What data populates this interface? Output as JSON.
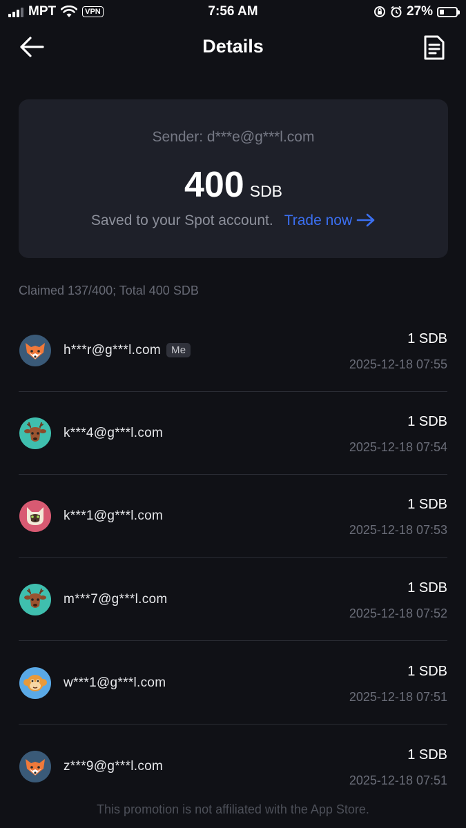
{
  "status_bar": {
    "carrier": "MPT",
    "vpn": "VPN",
    "time": "7:56 AM",
    "battery": "27%",
    "battery_level": 0.27
  },
  "header": {
    "title": "Details",
    "back_icon": "arrow-left-icon",
    "document_icon": "document-icon"
  },
  "summary": {
    "sender": "Sender: d***e@g***l.com",
    "amount": "400",
    "unit": "SDB",
    "saved_text": "Saved to your Spot account.",
    "trade_link": "Trade now",
    "accent_color": "#3b6ff0"
  },
  "claimed_text": "Claimed 137/400; Total 400 SDB",
  "claims": [
    {
      "email": "h***r@g***l.com",
      "badge": "Me",
      "amount": "1 SDB",
      "time": "2025-12-18 07:55",
      "avatar": "fox-icon"
    },
    {
      "email": "k***4@g***l.com",
      "badge": "",
      "amount": "1 SDB",
      "time": "2025-12-18 07:54",
      "avatar": "deer-icon"
    },
    {
      "email": "k***1@g***l.com",
      "badge": "",
      "amount": "1 SDB",
      "time": "2025-12-18 07:53",
      "avatar": "cat-icon"
    },
    {
      "email": "m***7@g***l.com",
      "badge": "",
      "amount": "1 SDB",
      "time": "2025-12-18 07:52",
      "avatar": "deer-icon"
    },
    {
      "email": "w***1@g***l.com",
      "badge": "",
      "amount": "1 SDB",
      "time": "2025-12-18 07:51",
      "avatar": "monkey-icon"
    },
    {
      "email": "z***9@g***l.com",
      "badge": "",
      "amount": "1 SDB",
      "time": "2025-12-18 07:51",
      "avatar": "fox-icon"
    }
  ],
  "disclaimer": "This promotion is not affiliated with the App Store."
}
